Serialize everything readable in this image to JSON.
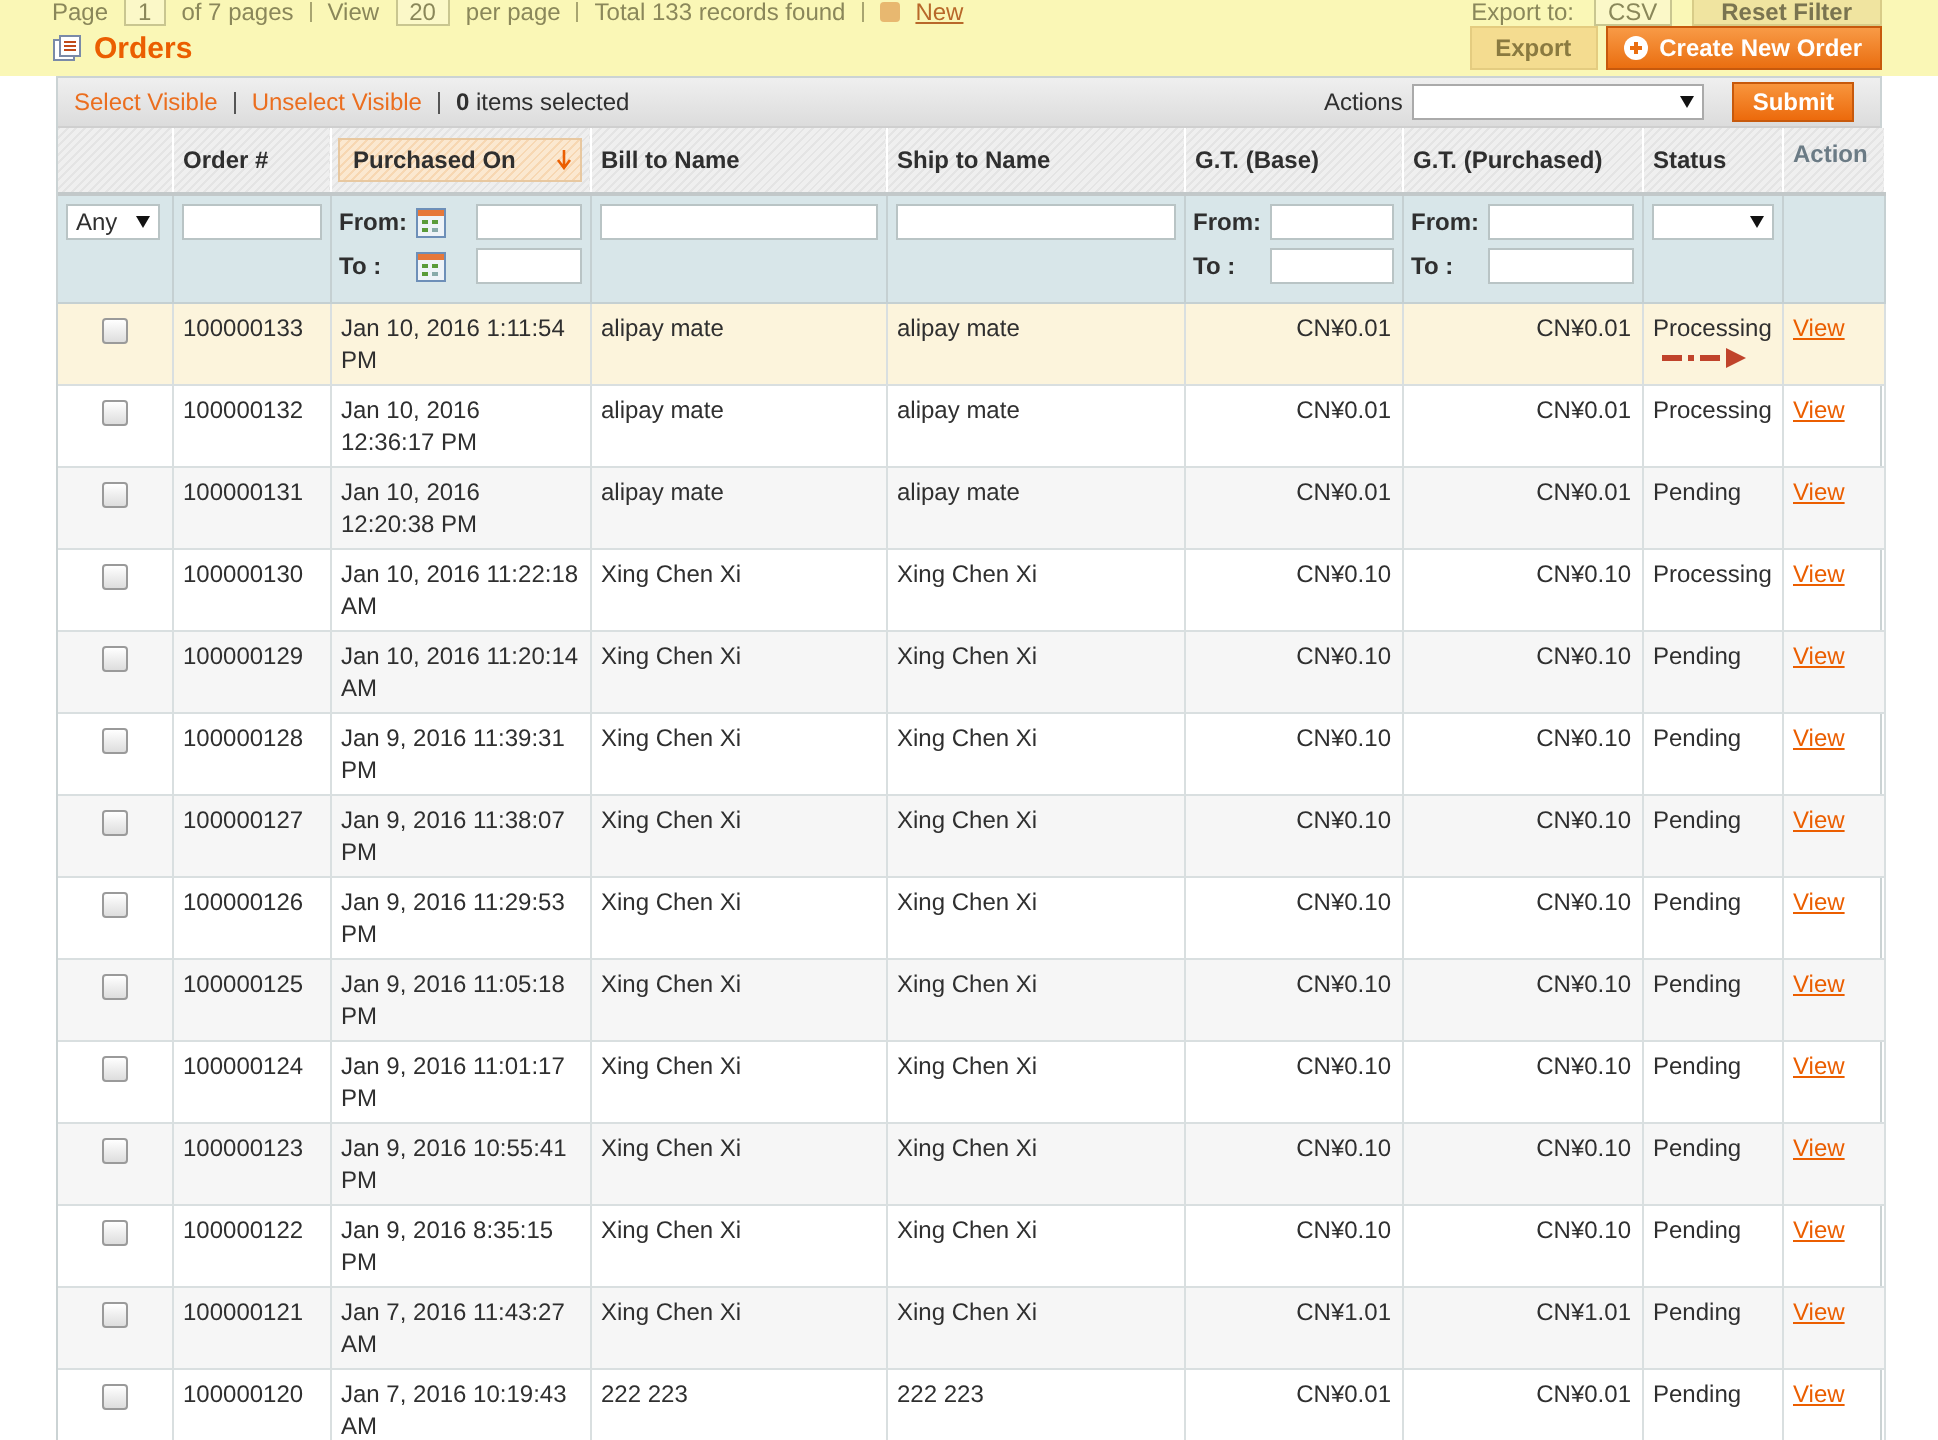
{
  "toolbar": {
    "page_label": "Page",
    "page_value": "1",
    "pages_text": "of 7 pages",
    "view_label": "View",
    "view_value": "20",
    "per_page": "per page",
    "total": "Total 133 records found",
    "rss_link": "New",
    "export_label": "Export to:",
    "export_format": "CSV",
    "reset_button": "Reset Filter",
    "export_button": "Export"
  },
  "title": "Orders",
  "create_button": "Create New Order",
  "massaction": {
    "select_visible": "Select Visible",
    "unselect_visible": "Unselect Visible",
    "count": "0",
    "count_text": "items selected",
    "actions_label": "Actions",
    "submit": "Submit"
  },
  "columns": [
    {
      "label": "Order #",
      "sortable": true,
      "sorted": false
    },
    {
      "label": "Purchased On",
      "sortable": true,
      "sorted": true
    },
    {
      "label": "Bill to Name",
      "sortable": true,
      "sorted": false
    },
    {
      "label": "Ship to Name",
      "sortable": true,
      "sorted": false
    },
    {
      "label": "G.T. (Base)",
      "sortable": true,
      "sorted": false
    },
    {
      "label": "G.T. (Purchased)",
      "sortable": true,
      "sorted": false
    },
    {
      "label": "Status",
      "sortable": true,
      "sorted": false
    },
    {
      "label": "Action",
      "sortable": false,
      "sorted": false
    }
  ],
  "filters": [
    {
      "kind": "select",
      "value": "Any"
    },
    {
      "kind": "text"
    },
    {
      "kind": "date_range",
      "from_label": "From:",
      "to_label": "To :"
    },
    {
      "kind": "text"
    },
    {
      "kind": "text"
    },
    {
      "kind": "range",
      "from_label": "From:",
      "to_label": "To :"
    },
    {
      "kind": "range",
      "from_label": "From:",
      "to_label": "To :"
    },
    {
      "kind": "select"
    },
    {
      "kind": "none"
    }
  ],
  "rows": [
    {
      "checked": false,
      "highlighted": true,
      "annotated": true,
      "order": "100000133",
      "date": "Jan 10, 2016 1:11:54 PM",
      "bill": "alipay mate",
      "ship": "alipay mate",
      "base": "CN¥0.01",
      "purchased": "CN¥0.01",
      "status": "Processing",
      "action": "View"
    },
    {
      "checked": false,
      "highlighted": false,
      "annotated": false,
      "order": "100000132",
      "date": "Jan 10, 2016 12:36:17 PM",
      "bill": "alipay mate",
      "ship": "alipay mate",
      "base": "CN¥0.01",
      "purchased": "CN¥0.01",
      "status": "Processing",
      "action": "View"
    },
    {
      "checked": false,
      "highlighted": false,
      "annotated": false,
      "order": "100000131",
      "date": "Jan 10, 2016 12:20:38 PM",
      "bill": "alipay mate",
      "ship": "alipay mate",
      "base": "CN¥0.01",
      "purchased": "CN¥0.01",
      "status": "Pending",
      "action": "View"
    },
    {
      "checked": false,
      "highlighted": false,
      "annotated": false,
      "order": "100000130",
      "date": "Jan 10, 2016 11:22:18 AM",
      "bill": "Xing Chen Xi",
      "ship": "Xing Chen Xi",
      "base": "CN¥0.10",
      "purchased": "CN¥0.10",
      "status": "Processing",
      "action": "View"
    },
    {
      "checked": false,
      "highlighted": false,
      "annotated": false,
      "order": "100000129",
      "date": "Jan 10, 2016 11:20:14 AM",
      "bill": "Xing Chen Xi",
      "ship": "Xing Chen Xi",
      "base": "CN¥0.10",
      "purchased": "CN¥0.10",
      "status": "Pending",
      "action": "View"
    },
    {
      "checked": false,
      "highlighted": false,
      "annotated": false,
      "order": "100000128",
      "date": "Jan 9, 2016 11:39:31 PM",
      "bill": "Xing Chen Xi",
      "ship": "Xing Chen Xi",
      "base": "CN¥0.10",
      "purchased": "CN¥0.10",
      "status": "Pending",
      "action": "View"
    },
    {
      "checked": false,
      "highlighted": false,
      "annotated": false,
      "order": "100000127",
      "date": "Jan 9, 2016 11:38:07 PM",
      "bill": "Xing Chen Xi",
      "ship": "Xing Chen Xi",
      "base": "CN¥0.10",
      "purchased": "CN¥0.10",
      "status": "Pending",
      "action": "View"
    },
    {
      "checked": false,
      "highlighted": false,
      "annotated": false,
      "order": "100000126",
      "date": "Jan 9, 2016 11:29:53 PM",
      "bill": "Xing Chen Xi",
      "ship": "Xing Chen Xi",
      "base": "CN¥0.10",
      "purchased": "CN¥0.10",
      "status": "Pending",
      "action": "View"
    },
    {
      "checked": false,
      "highlighted": false,
      "annotated": false,
      "order": "100000125",
      "date": "Jan 9, 2016 11:05:18 PM",
      "bill": "Xing Chen Xi",
      "ship": "Xing Chen Xi",
      "base": "CN¥0.10",
      "purchased": "CN¥0.10",
      "status": "Pending",
      "action": "View"
    },
    {
      "checked": false,
      "highlighted": false,
      "annotated": false,
      "order": "100000124",
      "date": "Jan 9, 2016 11:01:17 PM",
      "bill": "Xing Chen Xi",
      "ship": "Xing Chen Xi",
      "base": "CN¥0.10",
      "purchased": "CN¥0.10",
      "status": "Pending",
      "action": "View"
    },
    {
      "checked": false,
      "highlighted": false,
      "annotated": false,
      "order": "100000123",
      "date": "Jan 9, 2016 10:55:41 PM",
      "bill": "Xing Chen Xi",
      "ship": "Xing Chen Xi",
      "base": "CN¥0.10",
      "purchased": "CN¥0.10",
      "status": "Pending",
      "action": "View"
    },
    {
      "checked": false,
      "highlighted": false,
      "annotated": false,
      "order": "100000122",
      "date": "Jan 9, 2016 8:35:15 PM",
      "bill": "Xing Chen Xi",
      "ship": "Xing Chen Xi",
      "base": "CN¥0.10",
      "purchased": "CN¥0.10",
      "status": "Pending",
      "action": "View"
    },
    {
      "checked": false,
      "highlighted": false,
      "annotated": false,
      "order": "100000121",
      "date": "Jan 7, 2016 11:43:27 AM",
      "bill": "Xing Chen Xi",
      "ship": "Xing Chen Xi",
      "base": "CN¥1.01",
      "purchased": "CN¥1.01",
      "status": "Pending",
      "action": "View"
    },
    {
      "checked": false,
      "highlighted": false,
      "annotated": false,
      "order": "100000120",
      "date": "Jan 7, 2016 10:19:43 AM",
      "bill": "222 223",
      "ship": "222 223",
      "base": "CN¥0.01",
      "purchased": "CN¥0.01",
      "status": "Pending",
      "action": "View"
    }
  ]
}
